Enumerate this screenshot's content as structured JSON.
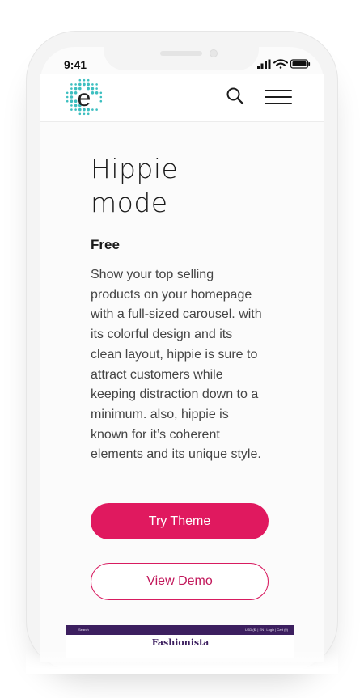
{
  "status_bar": {
    "time": "9:41"
  },
  "header": {
    "logo_letter": "e",
    "search_icon": "search-icon",
    "menu_icon": "hamburger-menu-icon"
  },
  "theme": {
    "title_line1": "Hippie",
    "title_line2": "mode",
    "price": "Free",
    "description_lines": [
      "Show your top selling",
      "products on your homepage",
      "with a full-sized carousel. with",
      "its colorful design and its",
      "clean layout, hippie is sure to",
      "attract customers while",
      "keeping distraction down to a",
      "minimum. also, hippie is",
      "known for it’s coherent",
      "elements and its unique style."
    ]
  },
  "actions": {
    "try_label": "Try Theme",
    "demo_label": "View Demo"
  },
  "preview": {
    "search_label": "Search",
    "top_right": "USD ($)  |  EN  |  Login  |  Cart (0)",
    "brand": "Fashionista"
  },
  "colors": {
    "accent": "#e0195f",
    "logo_teal": "#3dbfc0",
    "preview_bar": "#3c1f5f"
  }
}
